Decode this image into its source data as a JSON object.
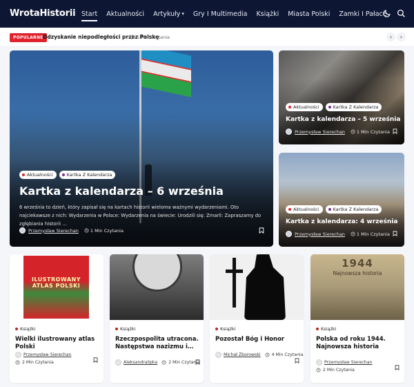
{
  "header": {
    "logo": "WrotaHistorii",
    "nav": [
      {
        "label": "Start"
      },
      {
        "label": "Aktualności"
      },
      {
        "label": "Artykuły"
      },
      {
        "label": "Gry I Multimedia"
      },
      {
        "label": "Książki"
      },
      {
        "label": "Miasta Polski"
      },
      {
        "label": "Zamki I Pałace"
      }
    ],
    "icons": [
      "moon-icon",
      "search-icon"
    ]
  },
  "ticker": {
    "badge": "POPULARNE",
    "title": "Odzyskanie niepodległości przez Polskę",
    "time": "5 Min Czytania"
  },
  "hero": {
    "cats": [
      "Aktualności",
      "Kartka Z Kalendarza"
    ],
    "title": "Kartka z kalendarza – 6 września",
    "excerpt": "6 września to dzień, który zapisał się na kartach historii wieloma ważnymi wydarzeniami. Oto najciekawsze z nich: Wydarzenia w Polsce: Wydarzenia na świecie: Urodzili się: Zmarli: Zapraszamy do zgłębiania historii …",
    "author": "Przemysław Sierechan",
    "time": "1 Min Czytania"
  },
  "side1": {
    "cats": [
      "Aktualności",
      "Kartka Z Kalendarza"
    ],
    "title": "Kartka z kalendarza – 5 września",
    "author": "Przemysław Sierechan",
    "time": "1 Min Czytania"
  },
  "side2": {
    "cats": [
      "Aktualności",
      "Kartka Z Kalendarza"
    ],
    "title": "Kartka z kalendarza: 4 września",
    "author": "Przemysław Sierechan",
    "time": "1 Min Czytania"
  },
  "cards": [
    {
      "cat": "Książki",
      "title": "Wielki ilustrowany atlas Polski",
      "author": "Przemysław Sierechan",
      "time": "2 Min Czytania",
      "thumb_text": "ILUSTROWANY ATLAS POLSKI"
    },
    {
      "cat": "Książki",
      "title": "Rzeczpospolita utracona. Następstwa nazizmu i…",
      "author": "Aleksandralipka",
      "time": "2 Min Czytania"
    },
    {
      "cat": "Książki",
      "title": "Pozostał Bóg i Honor",
      "author": "Michał Zborowski",
      "time": "4 Min Czytania"
    },
    {
      "cat": "Książki",
      "title": "Polska od roku 1944. Najnowsza historia",
      "author": "Przemysław Sierechan",
      "time": "2 Min Czytania",
      "thumb_year": "1944",
      "thumb_sub": "Najnowsza historia"
    }
  ],
  "colors": {
    "header_bg": "#0d1734",
    "accent_red": "#e0232d",
    "accent_purple": "#7c2a9b",
    "page_bg": "#f5f6fa"
  }
}
